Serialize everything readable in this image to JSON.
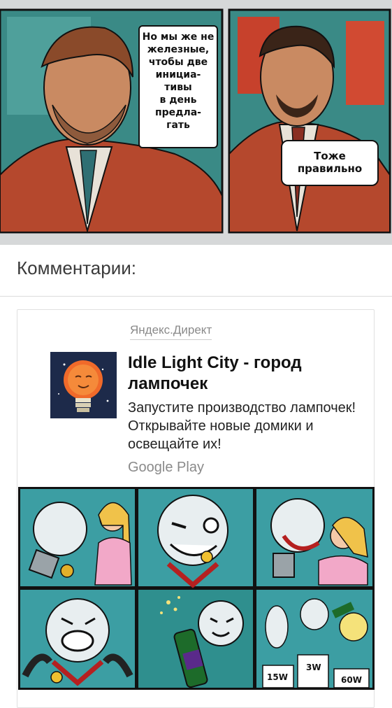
{
  "comic": {
    "bubble_left_lines": [
      "Но мы же не",
      "железные,",
      "чтобы две",
      "инициа-",
      "тивы",
      "в день",
      "предла-",
      "гать"
    ],
    "bubble_right": "Тоже правильно"
  },
  "comments": {
    "title": "Комментарии:"
  },
  "ad": {
    "source": "Яндекс.Директ",
    "title": "Idle Light City - город лампочек",
    "description": "Запустите производство лампочек! Открывайте новые домики и освещайте их!",
    "store": "Google Play",
    "wattage_labels": [
      "15W",
      "3W",
      "60W"
    ]
  }
}
